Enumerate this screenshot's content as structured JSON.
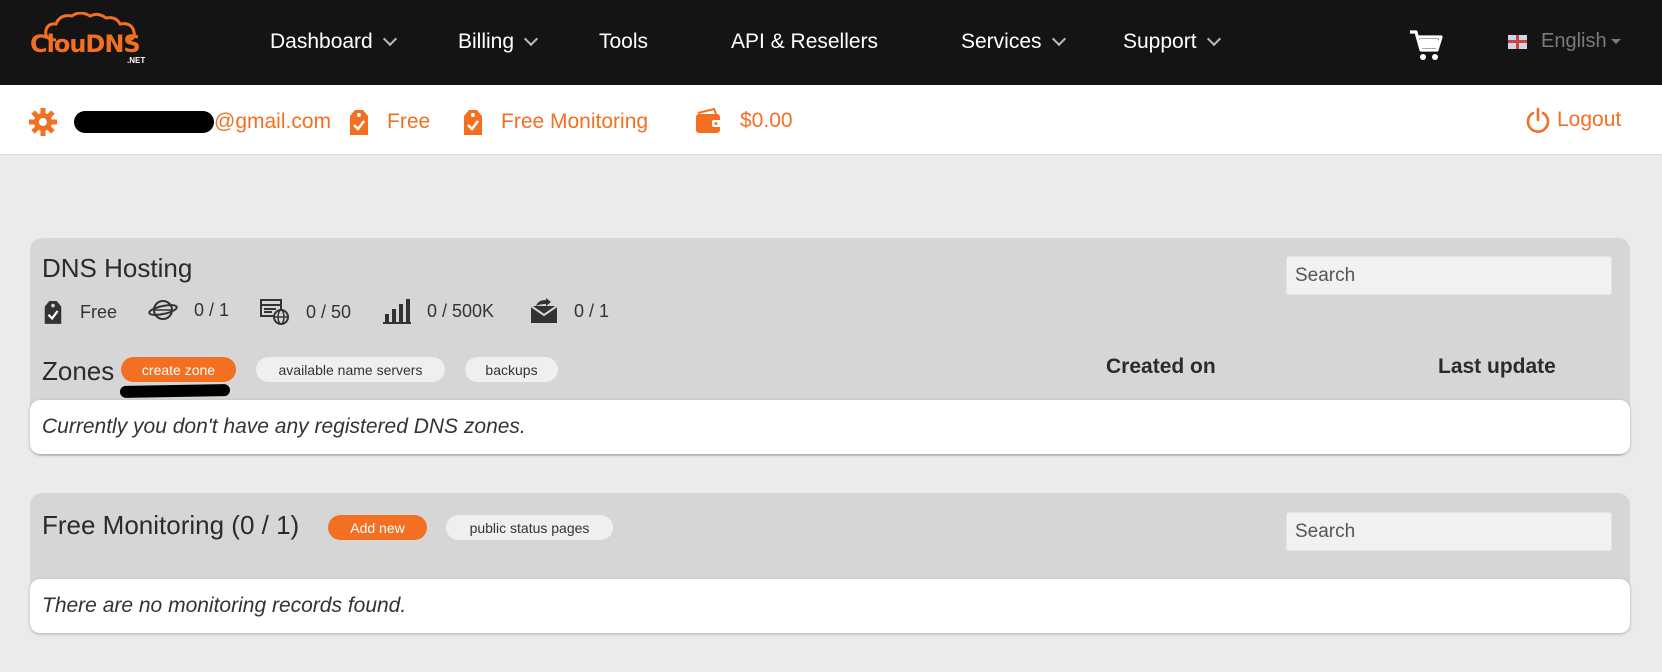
{
  "brand": {
    "logo_text": "ClouDNS",
    "logo_sub": ".NET",
    "accent": "#f36f21"
  },
  "nav": {
    "items": [
      {
        "label": "Dashboard",
        "dropdown": true
      },
      {
        "label": "Billing",
        "dropdown": true
      },
      {
        "label": "Tools",
        "dropdown": false
      },
      {
        "label": "API & Resellers",
        "dropdown": false
      },
      {
        "label": "Services",
        "dropdown": true
      },
      {
        "label": "Support",
        "dropdown": true
      }
    ],
    "cart_icon": "cart-icon",
    "language": "English"
  },
  "account": {
    "email_suffix": "@gmail.com",
    "plan": "Free",
    "monitoring": "Free Monitoring",
    "balance": "$0.00",
    "logout": "Logout"
  },
  "dns_hosting": {
    "title": "DNS Hosting",
    "search_placeholder": "Search",
    "stats": [
      {
        "icon": "tag-check-icon",
        "value": "Free"
      },
      {
        "icon": "globe-icon",
        "value": "0 / 1"
      },
      {
        "icon": "server-globe-icon",
        "value": "0 / 50"
      },
      {
        "icon": "bar-chart-icon",
        "value": "0 / 500K"
      },
      {
        "icon": "mail-forward-icon",
        "value": "0 / 1"
      }
    ],
    "zones_label": "Zones",
    "create_zone": "create zone",
    "available_name_servers": "available name servers",
    "backups": "backups",
    "col_created": "Created on",
    "col_updated": "Last update",
    "empty_message": "Currently you don't have any registered DNS zones."
  },
  "monitoring": {
    "title": "Free Monitoring (0 / 1)",
    "add_new": "Add new",
    "public_status_pages": "public status pages",
    "search_placeholder": "Search",
    "empty_message": "There are no monitoring records found."
  }
}
